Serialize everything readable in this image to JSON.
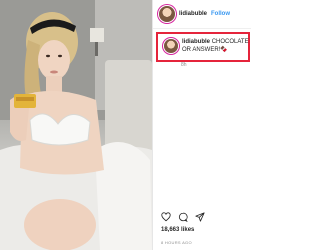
{
  "post": {
    "username": "lidiabuble",
    "follow_label": "Follow",
    "caption_user": "lidiabuble",
    "caption_text": "CHOCOLATE OR ANSWER!🍫",
    "caption_age": "8h",
    "likes": "18,663 likes",
    "posted": "8 HOURS AGO"
  },
  "icons": [
    "heart-icon",
    "comment-icon",
    "share-icon"
  ],
  "colors": {
    "highlight": "#e5243b",
    "link": "#3897f0"
  }
}
